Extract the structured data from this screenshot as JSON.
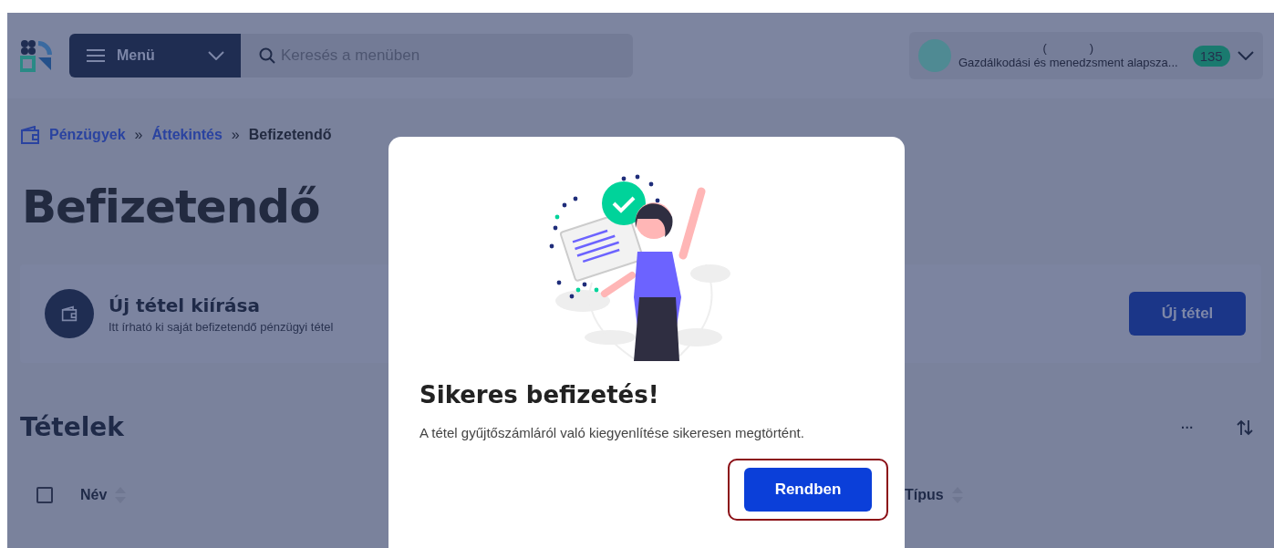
{
  "header": {
    "menu_label": "Menü",
    "search": {
      "placeholder": "Keresés a menüben"
    },
    "user": {
      "line_1": "(             )",
      "line_2": "Gazdálkodási és menedzsment alapsza...",
      "badge": "135"
    }
  },
  "breadcrumb": [
    {
      "label": "Pénzügyek",
      "kind": "link"
    },
    {
      "label": "»",
      "kind": "separator"
    },
    {
      "label": "Áttekintés",
      "kind": "link"
    },
    {
      "label": "»",
      "kind": "separator"
    },
    {
      "label": "Befizetendő",
      "kind": "current"
    }
  ],
  "page_title": "Befizetendő",
  "new_item_card": {
    "title": "Új tétel kiírása",
    "subtitle": "Itt írható ki saját befizetendő pénzügyi tétel",
    "button": "Új tétel"
  },
  "items_section": {
    "title": "Tételek",
    "more": "···",
    "select_all": {
      "checked": false
    },
    "columns": [
      {
        "label": "Név"
      },
      {
        "label": "Típus"
      }
    ]
  },
  "dialog": {
    "title": "Sikeres befizetés!",
    "message": "A tétel gyűjtőszámláról való kiegyenlítése sikeresen megtörtént.",
    "button": "Rendben",
    "button_highlighted": true
  }
}
